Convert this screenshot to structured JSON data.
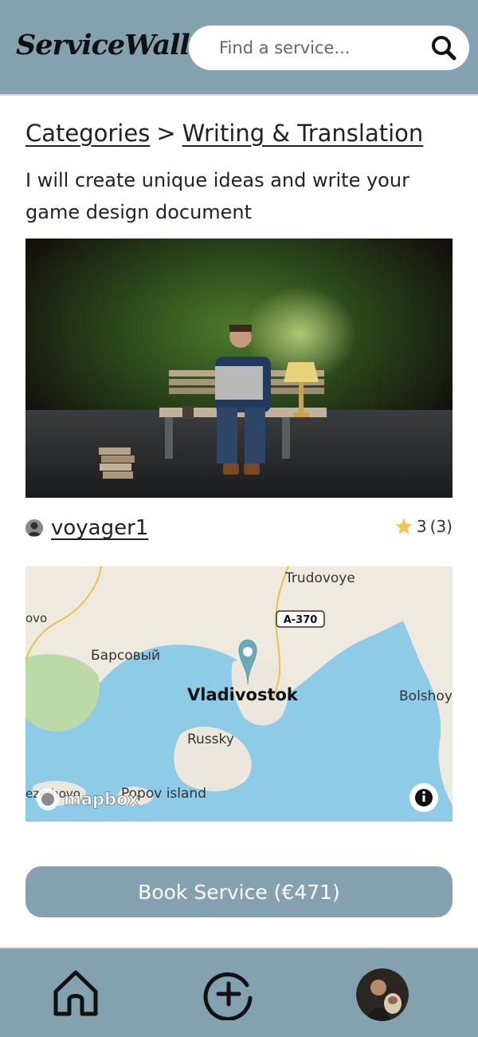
{
  "header": {
    "logo": "ServiceWall",
    "search_placeholder": "Find a service..."
  },
  "breadcrumb": {
    "root": "Categories",
    "separator": ">",
    "current": "Writing & Translation"
  },
  "service": {
    "title": "I will create unique ideas and write your game design document",
    "seller": "voyager1",
    "rating_value": "3",
    "rating_count": "(3)"
  },
  "map": {
    "labels": {
      "trudovoye": "Trudovoye",
      "road": "A-370",
      "ovo": "ovo",
      "barsovy": "Барсовый",
      "city": "Vladivostok",
      "bolshoy": "Bolshoy",
      "russky": "Russky",
      "popov": "Popov island",
      "zerhovo": "ezerhovo"
    },
    "attribution": "mapbox",
    "info_icon": "info-icon"
  },
  "book_button": "Book Service (€471)",
  "colors": {
    "brand": "#84a1b0",
    "water": "#8ecbe6",
    "marker": "#6aa9ba",
    "star": "#f2c94c"
  },
  "footer": {
    "icons": [
      "home-icon",
      "add-circle-icon",
      "profile-avatar"
    ]
  }
}
